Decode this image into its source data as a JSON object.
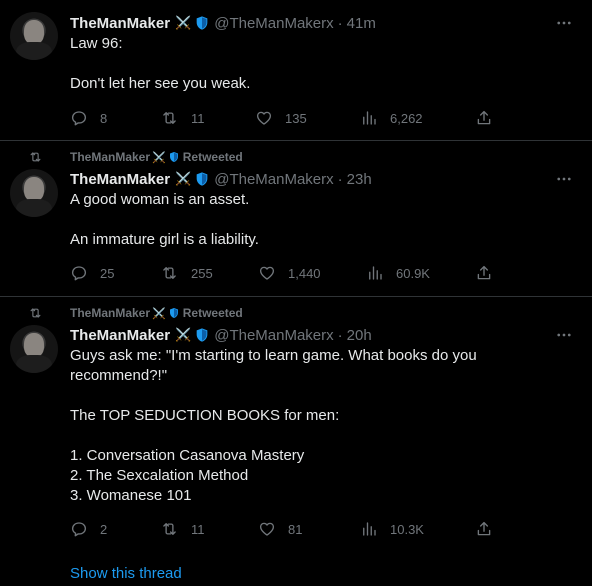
{
  "colors": {
    "background": "#000000",
    "text": "#e7e9ea",
    "muted": "#71767b",
    "link": "#1d9bf0",
    "divider": "#2f3336",
    "verified_badge": "#1d9bf0"
  },
  "tweets": [
    {
      "retweeted": false,
      "name": "TheManMaker",
      "name_emoji": "⚔️",
      "handle": "@TheManMakerx",
      "time": "41m",
      "lines": [
        "Law 96:",
        "",
        "Don't let her see you weak."
      ],
      "replies": "8",
      "retweets": "11",
      "likes": "135",
      "views": "6,262"
    },
    {
      "retweeted": true,
      "retweeted_by": "TheManMaker",
      "retweeted_label": "Retweeted",
      "name": "TheManMaker",
      "name_emoji": "⚔️",
      "handle": "@TheManMakerx",
      "time": "23h",
      "lines": [
        "A good woman is an asset.",
        "",
        "An immature girl is a liability."
      ],
      "replies": "25",
      "retweets": "255",
      "likes": "1,440",
      "views": "60.9K"
    },
    {
      "retweeted": true,
      "retweeted_by": "TheManMaker",
      "retweeted_label": "Retweeted",
      "name": "TheManMaker",
      "name_emoji": "⚔️",
      "handle": "@TheManMakerx",
      "time": "20h",
      "lines": [
        "Guys ask me: \"I'm starting to learn game. What books do you",
        "recommend?!\"",
        "",
        "The TOP SEDUCTION BOOKS for men:",
        "",
        "1. Conversation Casanova Mastery",
        "2. The Sexcalation Method",
        "3. Womanese 101"
      ],
      "replies": "2",
      "retweets": "11",
      "likes": "81",
      "views": "10.3K",
      "show_thread": "Show this thread"
    }
  ]
}
